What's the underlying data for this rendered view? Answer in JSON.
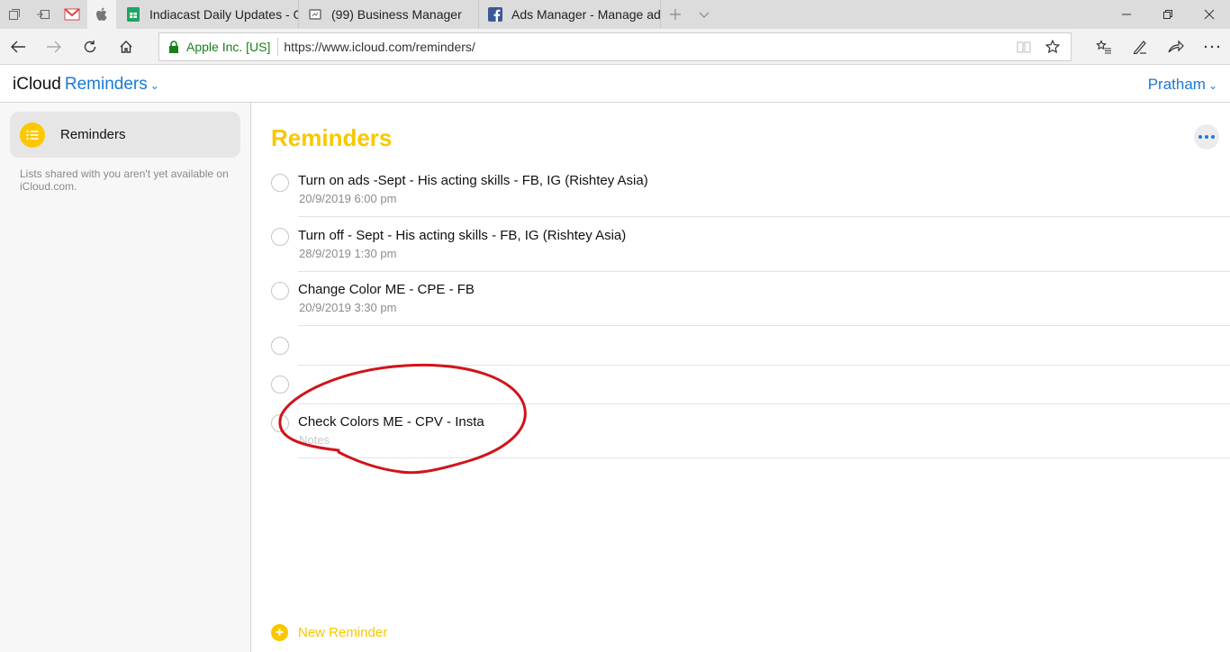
{
  "browser": {
    "tabs": [
      {
        "label": "Indiacast Daily Updates - Go",
        "icon": "google-sheets-icon"
      },
      {
        "label": "(99) Business Manager",
        "icon": "business-manager-icon"
      },
      {
        "label": "Ads Manager - Manage ads",
        "icon": "facebook-icon"
      }
    ],
    "address": {
      "cert": "Apple Inc. [US]",
      "url": "https://www.icloud.com/reminders/"
    }
  },
  "header": {
    "brand": "iCloud",
    "app": "Reminders",
    "user": "Pratham"
  },
  "sidebar": {
    "list_name": "Reminders",
    "shared_note": "Lists shared with you aren't yet available on iCloud.com."
  },
  "main": {
    "title": "Reminders",
    "reminders": [
      {
        "title": "Turn on ads -Sept - His acting skills - FB, IG (Rishtey Asia)",
        "due": "20/9/2019 6:00 pm"
      },
      {
        "title": "Turn off - Sept - His acting skills - FB, IG (Rishtey Asia)",
        "due": "28/9/2019 1:30 pm"
      },
      {
        "title": "Change Color ME - CPE - FB",
        "due": "20/9/2019 3:30 pm"
      },
      {
        "title": "",
        "due": ""
      },
      {
        "title": "",
        "due": ""
      },
      {
        "title": "Check Colors ME - CPV - Insta",
        "due": ""
      }
    ],
    "notes_placeholder": "Notes",
    "new_reminder": "New Reminder"
  },
  "colors": {
    "accent_yellow": "#f9c700",
    "link_blue": "#1b79d6",
    "annotation_red": "#d0141a"
  }
}
